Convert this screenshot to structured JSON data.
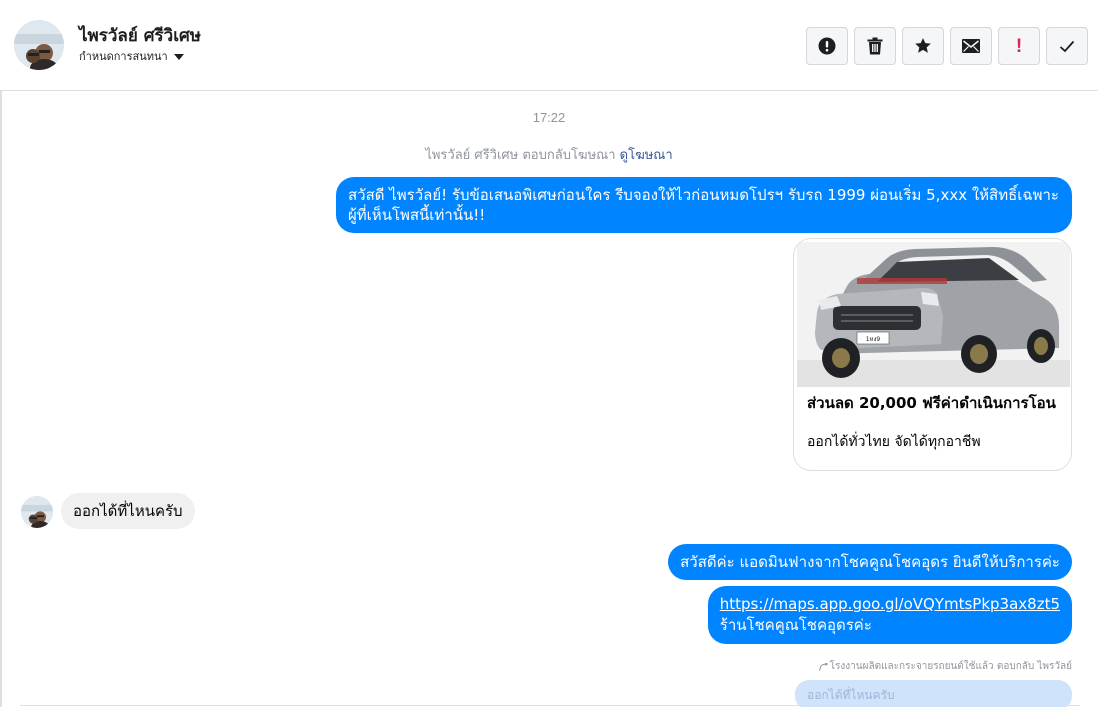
{
  "header": {
    "contact_name": "ไพรวัลย์ ศรีวิเศษ",
    "conversation_settings_label": "กำหนดการสนทนา",
    "actions": [
      {
        "name": "report-icon"
      },
      {
        "name": "trash-icon"
      },
      {
        "name": "star-icon"
      },
      {
        "name": "envelope-icon"
      },
      {
        "name": "exclamation-icon",
        "glyph": "!"
      },
      {
        "name": "checkmark-icon"
      }
    ]
  },
  "thread": {
    "timestamp": "17:22",
    "ad_reply": {
      "prefix": "ไพรวัลย์ ศรีวิเศษ ตอบกลับโฆษณา",
      "link": "ดูโฆษณา"
    },
    "messages": {
      "outgoing_1": "สวัสดี ไพรวัลย์! รับข้อเสนอพิเศษก่อนใคร รีบจองให้ไวก่อนหมดโปรฯ รับรถ 1999 ผ่อนเริ่ม 5,xxx ให้สิทธิ์เฉพาะผู้ที่เห็นโพสนี้เท่านั้น!!",
      "ad_card": {
        "title": "ส่วนลด 20,000 ฟรีค่าดำเนินการโอน",
        "subtitle": "ออกได้ทั่วไทย จัดได้ทุกอาชีพ",
        "plate_text": "1หง9"
      },
      "incoming_1": "ออกได้ที่ไหนครับ",
      "outgoing_2": "สวัสดีค่ะ แอดมินฟางจากโชคคูณโชคอุดร ยินดีให้บริการค่ะ",
      "outgoing_3": {
        "link": "https://maps.app.goo.gl/oVQYmtsPkp3ax8zt5",
        "text": "ร้านโชคคูณโชคอุดรค่ะ"
      },
      "footnote": "โรงงานผลิตและกระจายรถยนต์ใช้แล้ว ตอบกลับ ไพรวัลย์",
      "partial_bubble": "ออกได้ที่ไหนครับ"
    }
  },
  "colors": {
    "outgoing_bubble": "#0084ff",
    "incoming_bubble": "#f1f0f0",
    "link": "#385898",
    "alert_red": "#e0245e"
  }
}
